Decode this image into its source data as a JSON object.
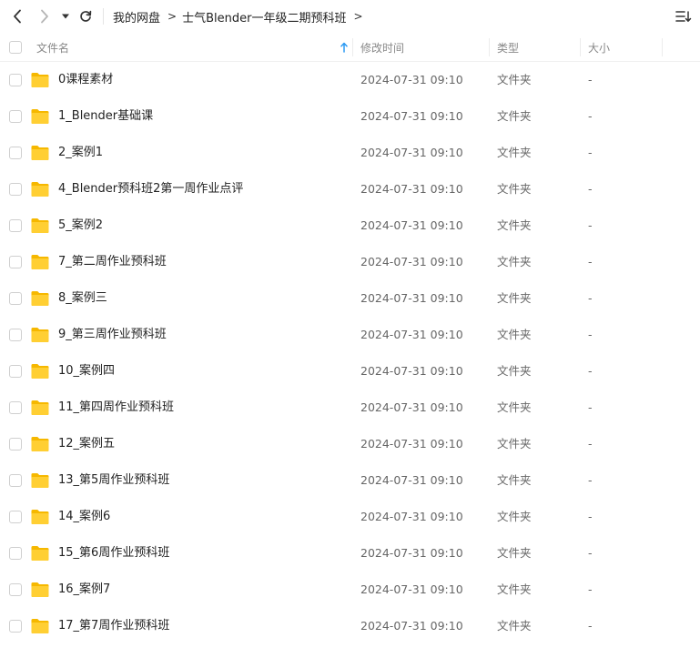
{
  "breadcrumb": {
    "items": [
      "我的网盘",
      "士气Blender一年级二期预科班"
    ],
    "separator": ">"
  },
  "columns": {
    "name": "文件名",
    "mtime": "修改时间",
    "type": "类型",
    "size": "大小"
  },
  "colors": {
    "folder_back": "#f6b800",
    "folder_front": "#ffcf33",
    "accent": "#2b9af3"
  },
  "icons": {
    "back": "chevron-left-icon",
    "forward": "chevron-right-icon",
    "dropdown": "caret-down-icon",
    "refresh": "refresh-icon",
    "sort_view": "sort-list-icon",
    "sort_arrow": "arrow-up-icon",
    "folder": "folder-icon"
  },
  "files": [
    {
      "name": "0课程素材",
      "mtime": "2024-07-31 09:10",
      "type": "文件夹",
      "size": "-"
    },
    {
      "name": "1_Blender基础课",
      "mtime": "2024-07-31 09:10",
      "type": "文件夹",
      "size": "-"
    },
    {
      "name": "2_案例1",
      "mtime": "2024-07-31 09:10",
      "type": "文件夹",
      "size": "-"
    },
    {
      "name": "4_Blender预科班2第一周作业点评",
      "mtime": "2024-07-31 09:10",
      "type": "文件夹",
      "size": "-"
    },
    {
      "name": "5_案例2",
      "mtime": "2024-07-31 09:10",
      "type": "文件夹",
      "size": "-"
    },
    {
      "name": "7_第二周作业预科班",
      "mtime": "2024-07-31 09:10",
      "type": "文件夹",
      "size": "-"
    },
    {
      "name": "8_案例三",
      "mtime": "2024-07-31 09:10",
      "type": "文件夹",
      "size": "-"
    },
    {
      "name": "9_第三周作业预科班",
      "mtime": "2024-07-31 09:10",
      "type": "文件夹",
      "size": "-"
    },
    {
      "name": "10_案例四",
      "mtime": "2024-07-31 09:10",
      "type": "文件夹",
      "size": "-"
    },
    {
      "name": "11_第四周作业预科班",
      "mtime": "2024-07-31 09:10",
      "type": "文件夹",
      "size": "-"
    },
    {
      "name": "12_案例五",
      "mtime": "2024-07-31 09:10",
      "type": "文件夹",
      "size": "-"
    },
    {
      "name": "13_第5周作业预科班",
      "mtime": "2024-07-31 09:10",
      "type": "文件夹",
      "size": "-"
    },
    {
      "name": "14_案例6",
      "mtime": "2024-07-31 09:10",
      "type": "文件夹",
      "size": "-"
    },
    {
      "name": "15_第6周作业预科班",
      "mtime": "2024-07-31 09:10",
      "type": "文件夹",
      "size": "-"
    },
    {
      "name": "16_案例7",
      "mtime": "2024-07-31 09:10",
      "type": "文件夹",
      "size": "-"
    },
    {
      "name": "17_第7周作业预科班",
      "mtime": "2024-07-31 09:10",
      "type": "文件夹",
      "size": "-"
    }
  ]
}
